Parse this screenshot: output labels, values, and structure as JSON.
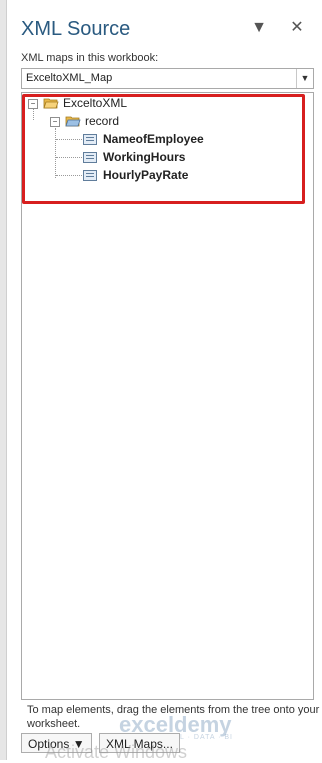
{
  "pane": {
    "title": "XML Source",
    "dropdown_glyph": "▼",
    "close_glyph": "✕"
  },
  "maps": {
    "label": "XML maps in this workbook:",
    "selected": "ExceltoXML_Map"
  },
  "tree": {
    "root": "ExceltoXML",
    "record": "record",
    "fields": [
      "NameofEmployee",
      "WorkingHours",
      "HourlyPayRate"
    ]
  },
  "hint": "To map elements, drag the elements from the tree onto your worksheet.",
  "buttons": {
    "options": "Options ▼",
    "xml_maps": "XML Maps..."
  },
  "overlay": {
    "watermark": "exceldemy",
    "watermark_sub": "EXCEL · DATA · BI",
    "activate": "Activate Windows"
  },
  "colors": {
    "title": "#2a5a80",
    "highlight": "#d71f1f"
  }
}
